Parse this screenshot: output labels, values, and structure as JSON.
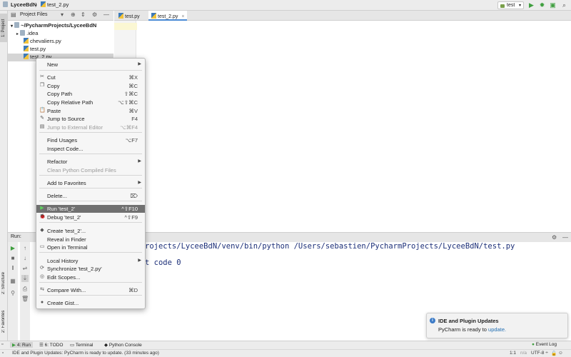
{
  "topbar": {
    "breadcrumb_project": "LyceeBdN",
    "breadcrumb_sep": "〉",
    "breadcrumb_file": "test_2.py",
    "run_config": "test"
  },
  "left_tool_tabs": [
    "1: Project",
    "2: Structure",
    "2: Favorites"
  ],
  "project_panel": {
    "title": "Project Files",
    "root": "~/PycharmProjects/LyceeBdN",
    "items": [
      ".idea",
      "chevaliers.py",
      "test.py",
      "test_2.py"
    ]
  },
  "editor_tabs": [
    {
      "label": "test.py",
      "active": false
    },
    {
      "label": "test_2.py",
      "active": true
    }
  ],
  "run_panel": {
    "label": "Run:",
    "console_lines": [
      "rojects/LyceeBdN/venv/bin/python /Users/sebastien/PycharmProjects/LyceeBdN/test.py",
      "t code 0"
    ]
  },
  "context_menu": {
    "items": [
      {
        "label": "New",
        "shortcut": "",
        "submenu": true,
        "icon": ""
      },
      {
        "label": "Cut",
        "shortcut": "⌘X",
        "icon": "scissors-icon",
        "glyph": "✂"
      },
      {
        "label": "Copy",
        "shortcut": "⌘C",
        "icon": "copy-icon",
        "glyph": "❐"
      },
      {
        "label": "Copy Path",
        "shortcut": "⇧⌘C"
      },
      {
        "label": "Copy Relative Path",
        "shortcut": "⌥⇧⌘C"
      },
      {
        "label": "Paste",
        "shortcut": "⌘V",
        "icon": "paste-icon",
        "glyph": "📋"
      },
      {
        "label": "Jump to Source",
        "shortcut": "F4",
        "icon": "pencil-icon",
        "glyph": "✎"
      },
      {
        "label": "Jump to External Editor",
        "shortcut": "⌥⌘F4",
        "disabled": true,
        "icon": "external-editor-icon",
        "glyph": "▤"
      },
      {
        "label": "Find Usages",
        "shortcut": "⌥F7"
      },
      {
        "label": "Inspect Code...",
        "shortcut": ""
      },
      {
        "label": "Refactor",
        "shortcut": "",
        "submenu": true
      },
      {
        "label": "Clean Python Compiled Files",
        "shortcut": "",
        "disabled": true
      },
      {
        "label": "Add to Favorites",
        "shortcut": "",
        "submenu": true
      },
      {
        "label": "Delete...",
        "shortcut": "⌦"
      },
      {
        "label": "Run 'test_2'",
        "shortcut": "^⇧F10",
        "highlighted": true,
        "icon": "run-icon",
        "glyph": "▶"
      },
      {
        "label": "Debug 'test_2'",
        "shortcut": "^⇧F9",
        "icon": "debug-icon",
        "glyph": "🐞"
      },
      {
        "label": "Create 'test_2'...",
        "shortcut": "",
        "icon": "python-icon",
        "glyph": "◆"
      },
      {
        "label": "Reveal in Finder",
        "shortcut": ""
      },
      {
        "label": "Open in Terminal",
        "shortcut": "",
        "icon": "terminal-icon",
        "glyph": "▭"
      },
      {
        "label": "Local History",
        "shortcut": "",
        "submenu": true
      },
      {
        "label": "Synchronize 'test_2.py'",
        "shortcut": "",
        "icon": "sync-icon",
        "glyph": "⟳"
      },
      {
        "label": "Edit Scopes...",
        "shortcut": "",
        "icon": "scopes-icon",
        "glyph": "◎"
      },
      {
        "label": "Compare With...",
        "shortcut": "⌘D",
        "icon": "compare-icon",
        "glyph": "⇆"
      },
      {
        "label": "Create Gist...",
        "shortcut": "",
        "icon": "github-icon",
        "glyph": "●"
      }
    ]
  },
  "notification": {
    "title": "IDE and Plugin Updates",
    "text": "PyCharm is ready to",
    "link": "update."
  },
  "bottom_tabs": [
    "4: Run",
    "6: TODO",
    "Terminal",
    "Python Console"
  ],
  "event_log": "Event Log",
  "status": {
    "message": "IDE and Plugin Updates: PyCharm is ready to update. (33 minutes ago)",
    "position": "1:1",
    "na": "n/a",
    "encoding": "UTF-8 ÷"
  },
  "colors": {
    "selection": "#707070",
    "accent": "#4b8bd5",
    "run_green": "#3f9f3f"
  }
}
